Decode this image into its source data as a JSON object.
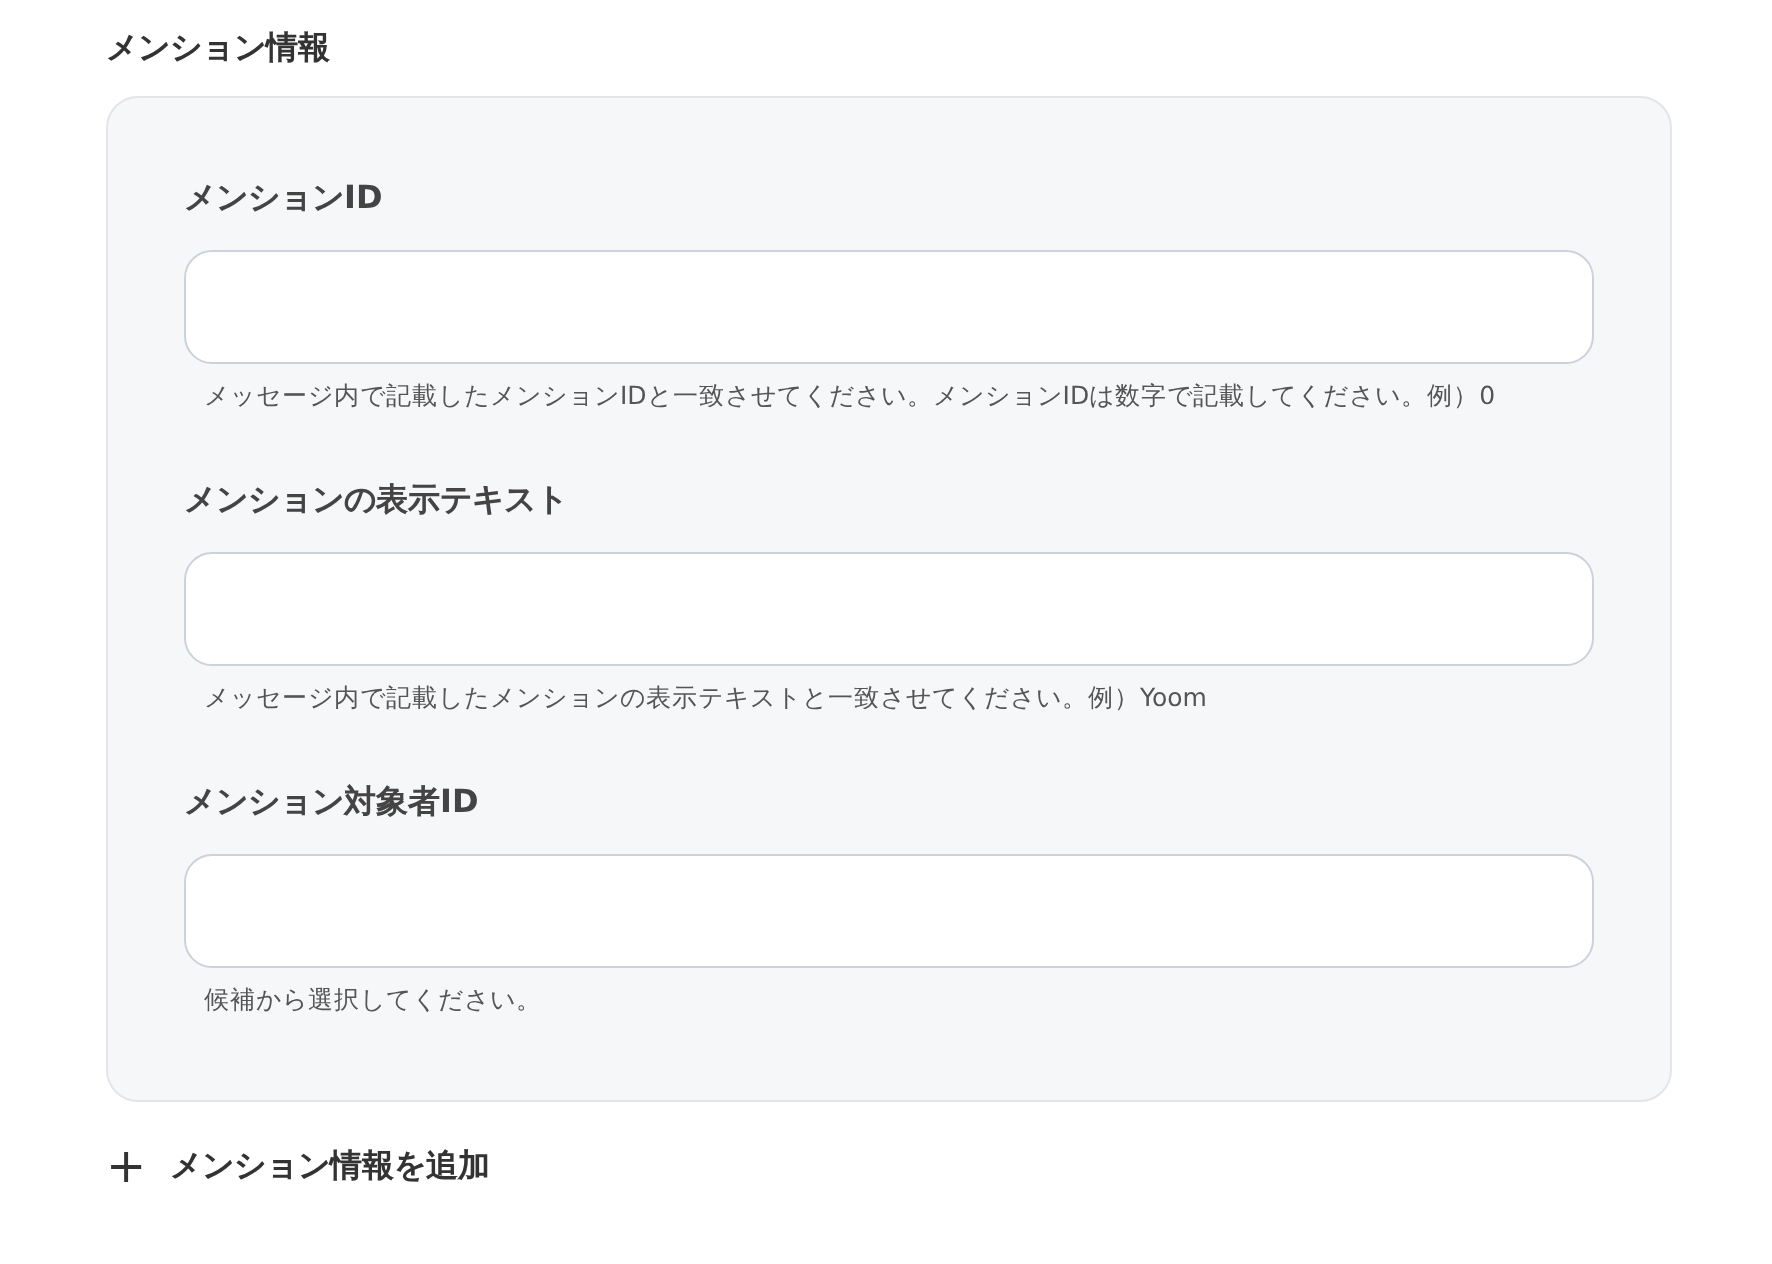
{
  "section_title": "メンション情報",
  "fields": [
    {
      "label": "メンションID",
      "hint": "メッセージ内で記載したメンションIDと一致させてください。メンションIDは数字で記載してください。例）0"
    },
    {
      "label": "メンションの表示テキスト",
      "hint": "メッセージ内で記載したメンションの表示テキストと一致させてください。例）Yoom"
    },
    {
      "label": "メンション対象者ID",
      "hint": "候補から選択してください。"
    }
  ],
  "add_button": {
    "icon": "+",
    "label": "メンション情報を追加"
  }
}
